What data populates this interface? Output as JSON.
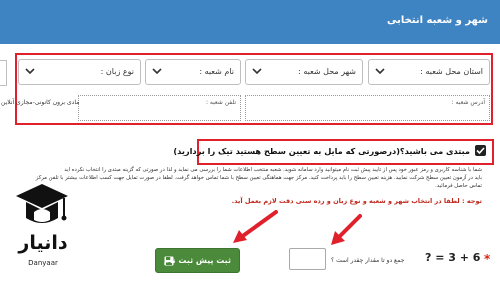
{
  "header": {
    "title": "شهر و شعبه انتخابی"
  },
  "selects": {
    "province": "استان محل شعبه :",
    "city": "شهر محل شعبه :",
    "branch_name": "نام شعبه :",
    "language": "نوع زبان :"
  },
  "fields": {
    "branch_address": "آدرس شعبه :",
    "branch_phone": "تلفن شعبه :",
    "side_note": "مادی برون کانونی-مجازی آنلاین"
  },
  "beginner": {
    "question": "مبتدی می باشید؟(درصورتی که مایل به تعیین سطح هستید تیک را بردارید)",
    "checked": true
  },
  "info_lines": [
    "شما با شناسه کاربری و رمز عبور خود پس از تایید پیش ثبت نام میتوانید وارد سامانه شوید. شعبه منتخب اطلاعات شما را بررسی می نماید و لذا در صورتی که گزینه مبتدی را انتخاب نکرده اید",
    "باید در آزمون تعیین سطح شرکت نمایید. هزینه تعیین سطح را باید پرداخت کنید. مرکز جهت هماهنگی تعیین سطح با شما تماس خواهد گرفت. لطفا در صورت تمایل جهت کسب اطلاعات بیشتر با تلفن مرکز",
    "تماس حاصل فرمائید."
  ],
  "warning": "توجه : لطفا در انتخاب شهر و شعبه و نوع زبان و رده سنی دقت لازم بعمل آید.",
  "captcha": {
    "question": "جمع دو تا مقدار چقدر است ؟",
    "equation": "? = 3 + 6",
    "required_mark": "*",
    "input_value": ""
  },
  "submit_label": "ثبت پیش ثبت نام",
  "logo": {
    "text": "دانیار",
    "subtext": "Danyaar"
  },
  "colors": {
    "header": "#3f84c2",
    "accent_red": "#e0212b",
    "button_green": "#4a8a3a",
    "warning_red": "#c0281d"
  }
}
